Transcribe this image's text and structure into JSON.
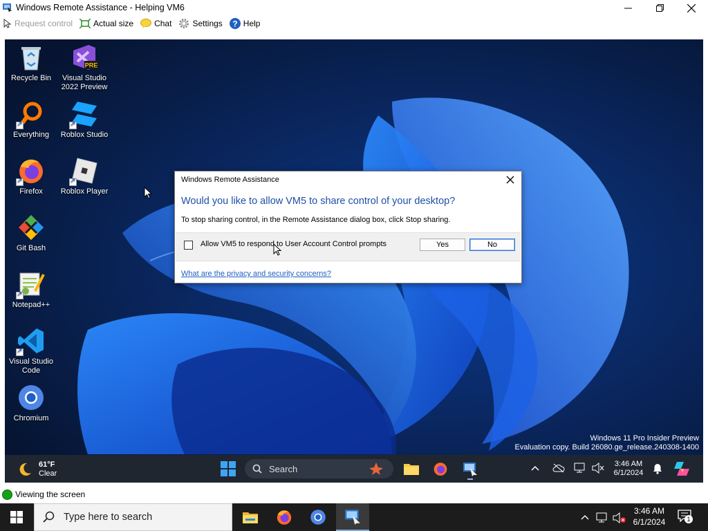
{
  "window": {
    "title": "Windows Remote Assistance - Helping VM6"
  },
  "toolbar": {
    "request_control": "Request control",
    "actual_size": "Actual size",
    "chat": "Chat",
    "settings": "Settings",
    "help": "Help"
  },
  "desktop": {
    "icons": [
      {
        "label": "Recycle Bin",
        "icon": "recycle-bin-icon"
      },
      {
        "label": "Visual Studio 2022 Preview",
        "icon": "visual-studio-preview-icon"
      },
      {
        "label": "Everything",
        "icon": "everything-search-icon"
      },
      {
        "label": "Roblox Studio",
        "icon": "roblox-studio-icon"
      },
      {
        "label": "Firefox",
        "icon": "firefox-icon"
      },
      {
        "label": "Roblox Player",
        "icon": "roblox-player-icon"
      },
      {
        "label": "Git Bash",
        "icon": "git-bash-icon"
      },
      {
        "label": "Notepad++",
        "icon": "notepad-plus-plus-icon"
      },
      {
        "label": "Visual Studio Code",
        "icon": "vscode-icon"
      },
      {
        "label": "Chromium",
        "icon": "chromium-icon"
      }
    ],
    "vs_badge": "PRE",
    "watermark_line1": "Windows 11 Pro Insider Preview",
    "watermark_line2": "Evaluation copy. Build 26080.ge_release.240308-1400"
  },
  "dialog": {
    "title": "Windows Remote Assistance",
    "heading": "Would you like to allow VM5 to share control of your desktop?",
    "text": "To stop sharing control, in the Remote Assistance dialog box, click Stop sharing.",
    "checkbox_label": "Allow VM5 to respond to User Account Control prompts",
    "checkbox_checked": false,
    "yes_label": "Yes",
    "no_label": "No",
    "link": "What are the privacy and security concerns?"
  },
  "inner_taskbar": {
    "weather_temp": "61°F",
    "weather_desc": "Clear",
    "search_label": "Search",
    "time": "3:46 AM",
    "date": "6/1/2024"
  },
  "status": {
    "text": "Viewing the screen",
    "color": "#16a016"
  },
  "host_taskbar": {
    "search_placeholder": "Type here to search",
    "time": "3:46 AM",
    "date": "6/1/2024",
    "notification_count": "1"
  }
}
